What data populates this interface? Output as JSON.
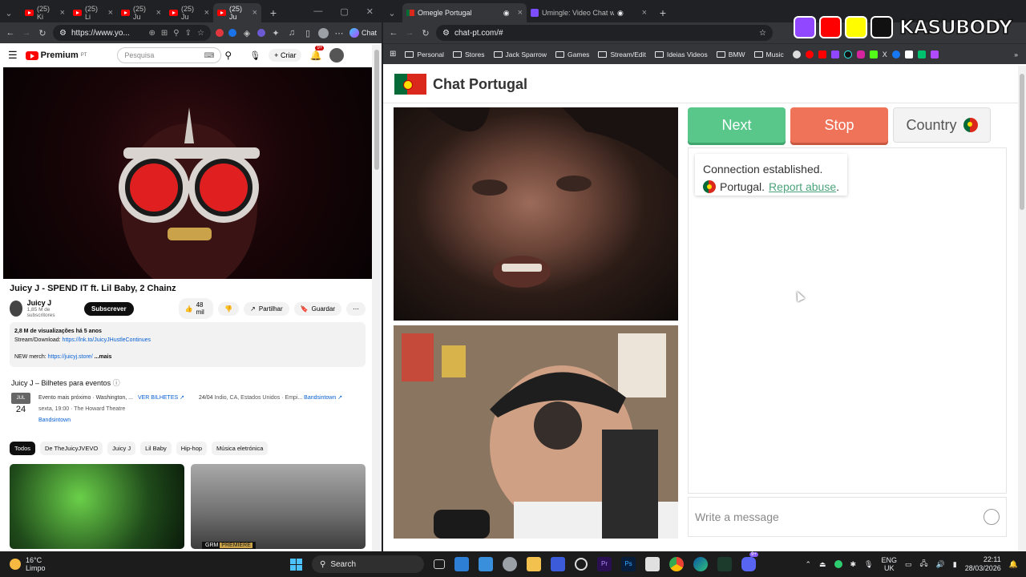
{
  "left_browser": {
    "tabs": [
      {
        "title": "(25) Ki"
      },
      {
        "title": "(25) Li"
      },
      {
        "title": "(25) Ju"
      },
      {
        "title": "(25) Ju"
      },
      {
        "title": "(25) Ju"
      }
    ],
    "url": "https://www.yo...",
    "chat_label": "Chat"
  },
  "youtube": {
    "logo": "Premium",
    "logo_sup": "PT",
    "search_placeholder": "Pesquisa",
    "create_label": "Criar",
    "notif_count": "9+",
    "video_title": "Juicy J - SPEND IT ft. Lil Baby, 2 Chainz",
    "channel_name": "Juicy J",
    "subscribers": "1,85 M de subscritores",
    "subscribe_label": "Subscrever",
    "likes": "48 mil",
    "share_label": "Partilhar",
    "save_label": "Guardar",
    "views": "2,8 M de visualizações  há 5 anos",
    "stream_label": "Stream/Download:",
    "stream_link": "https://lnk.to/JuicyJHustleContinues",
    "merch_label": "NEW merch:",
    "merch_link": "https://juicyj.store/",
    "more_label": "...mais",
    "events_heading": "Juicy J – Bilhetes para eventos",
    "event_month": "JUL",
    "event_day": "24",
    "event_title": "Evento mais próximo · Washington, ...",
    "event_when": "sexta, 19:00 · The Howard Theatre",
    "event_source": "Bandsintown",
    "tickets_label": "VER BILHETES",
    "event2_date": "24/04",
    "event2_place": "Indio, CA, Estados Unidos · Empi...",
    "event2_source": "Bandsintown",
    "chips": [
      "Todos",
      "De TheJuicyJVEVO",
      "Juicy J",
      "Lil Baby",
      "Hip-hop",
      "Música eletrónica"
    ],
    "thumb2_badge": "PREMIERE",
    "thumb2_brand": "GRM"
  },
  "right_browser": {
    "tabs": [
      {
        "title": "Omegle Portugal"
      },
      {
        "title": "Umingle: Video Chat with S"
      }
    ],
    "url": "chat-pt.com/#",
    "bookmarks": [
      "Personal",
      "Stores",
      "Jack Sparrow",
      "Games",
      "Stream/Edit",
      "Ideias Videos",
      "BMW",
      "Music"
    ]
  },
  "chat_site": {
    "title": "Chat Portugal",
    "next_label": "Next",
    "stop_label": "Stop",
    "country_label": "Country",
    "status_line": "Connection established.",
    "country_name": "Portugal.",
    "report_label": "Report abuse",
    "report_period": ".",
    "message_placeholder": "Write a message"
  },
  "overlay": {
    "name": "KASUBODY"
  },
  "taskbar": {
    "temperature": "16°C",
    "weather": "Limpo",
    "search_label": "Search",
    "lang1": "ENG",
    "lang2": "UK",
    "time": "22:11",
    "date": "28/03/2026",
    "discord_badge": "9+"
  }
}
